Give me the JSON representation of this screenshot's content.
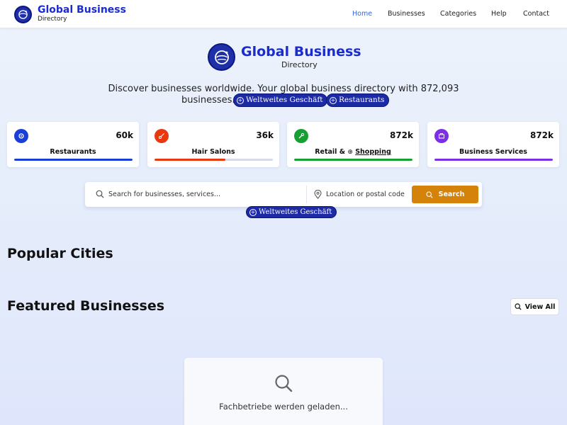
{
  "header": {
    "title": "Global Business",
    "subtitle": "Directory",
    "logo_icon": "globe-icon",
    "nav": [
      {
        "label": "Home",
        "active": true
      },
      {
        "label": "Businesses",
        "active": false
      },
      {
        "label": "Categories",
        "active": false
      },
      {
        "label": "Help",
        "active": false
      },
      {
        "label": "Contact",
        "active": false
      }
    ]
  },
  "hero": {
    "title": "Global Business",
    "subtitle": "Directory",
    "description_line1": "Discover businesses worldwide. Your global business directory with 872,093",
    "description_line2": "businesses.",
    "pills": [
      {
        "label": "Weltweites Geschäft",
        "icon": "plus-circle-icon"
      },
      {
        "label": "Restaurants",
        "icon": "plus-circle-icon"
      }
    ]
  },
  "stats": [
    {
      "label": "Restaurants",
      "value": "60k",
      "icon": "gear-icon",
      "color": "#1a3fd9",
      "progress": 1.0
    },
    {
      "label": "Hair Salons",
      "value": "36k",
      "icon": "scissors-icon",
      "color": "#e8380f",
      "progress": 0.6
    },
    {
      "label_prefix": "Retail & ",
      "label_link": "Shopping",
      "value": "872k",
      "icon": "wrench-icon",
      "color": "#16a034",
      "progress": 1.0
    },
    {
      "label": "Business Services",
      "value": "872k",
      "icon": "briefcase-icon",
      "color": "#7c2ee6",
      "progress": 1.0
    }
  ],
  "search": {
    "query_placeholder": "Search for businesses, services...",
    "location_placeholder": "Location or postal code",
    "button_label": "Search",
    "button_color": "#d5820b",
    "tag_pill": "Weltweites Geschäft"
  },
  "sections": {
    "popular_cities": "Popular Cities",
    "featured_businesses": "Featured Businesses",
    "view_all": "View All"
  },
  "loading": {
    "text": "Fachbetriebe werden geladen..."
  }
}
